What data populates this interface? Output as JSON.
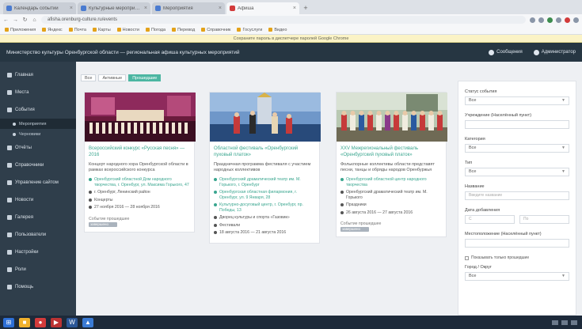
{
  "browser": {
    "tabs": [
      {
        "label": "Календарь событий",
        "active": false,
        "fav": "blue"
      },
      {
        "label": "Культурные мероприятия",
        "active": false,
        "fav": "blue"
      },
      {
        "label": "Мероприятия",
        "active": false,
        "fav": "blue"
      },
      {
        "label": "Афиша",
        "active": true,
        "fav": "red"
      }
    ],
    "url": "afisha.orenburg-culture.ru/events",
    "bookmarks": [
      "Приложения",
      "Яндекс",
      "Почта",
      "Карты",
      "Новости",
      "Погода",
      "Перевод",
      "Справочник",
      "Госуслуги",
      "Видео"
    ],
    "infobar": "Сохраните пароль в диспетчере паролей Google Chrome"
  },
  "app": {
    "title": "Министерство культуры Оренбургской области — региональная афиша культурных мероприятий",
    "header_links": [
      "Сообщения",
      "Администратор"
    ]
  },
  "sidebar": {
    "items": [
      {
        "label": "Главная",
        "sub": false,
        "active": false
      },
      {
        "label": "Места",
        "sub": false,
        "active": false
      },
      {
        "label": "События",
        "sub": false,
        "active": false
      },
      {
        "label": "Мероприятия",
        "sub": true,
        "active": true
      },
      {
        "label": "Черновики",
        "sub": true,
        "active": false
      },
      {
        "label": "Отчёты",
        "sub": false,
        "active": false
      },
      {
        "label": "Справочники",
        "sub": false,
        "active": false
      },
      {
        "label": "Управление сайтом",
        "sub": false,
        "active": false
      },
      {
        "label": "Новости",
        "sub": false,
        "active": false
      },
      {
        "label": "Галерея",
        "sub": false,
        "active": false
      },
      {
        "label": "Пользователи",
        "sub": false,
        "active": false
      },
      {
        "label": "Настройки",
        "sub": false,
        "active": false
      },
      {
        "label": "Роли",
        "sub": false,
        "active": false
      },
      {
        "label": "Помощь",
        "sub": false,
        "active": false
      }
    ]
  },
  "toolbar": {
    "tabs": [
      {
        "label": "Все",
        "active": false
      },
      {
        "label": "Активные",
        "active": false
      },
      {
        "label": "Прошедшие",
        "active": true
      }
    ]
  },
  "cards": [
    {
      "title": "Всероссийский конкурс «Русская песня» — 2016",
      "desc": "Концерт народного хора Оренбургской области в рамках всероссийского конкурса",
      "rows": [
        {
          "text": "Оренбургский областной Дом народного творчества, г. Оренбург, ул. Максима Горького, 47",
          "style": "link"
        },
        {
          "text": "г. Оренбург, Ленинский район",
          "style": "dark"
        },
        {
          "text": "Концерты",
          "style": "dark"
        },
        {
          "text": "27 ноября 2016 — 28 ноября 2016",
          "style": "dark"
        }
      ],
      "foot": "Событие прошедшее",
      "badge": "завершено"
    },
    {
      "title": "Областной фестиваль «Оренбургский пуховый платок»",
      "desc": "Праздничная программа фестиваля с участием народных коллективов",
      "rows": [
        {
          "text": "Оренбургский драматический театр им. М. Горького, г. Оренбург",
          "style": "link"
        },
        {
          "text": "Оренбургская областная филармония, г. Оренбург, ул. 9 Января, 28",
          "style": "link"
        },
        {
          "text": "Культурно-досуговый центр, г. Оренбург, пр. Победы, 13",
          "style": "link"
        },
        {
          "text": "Дворец культуры и спорта «Газовик»",
          "style": "dark"
        },
        {
          "text": "Фестивали",
          "style": "dark"
        },
        {
          "text": "18 августа 2016 — 21 августа 2016",
          "style": "dark"
        }
      ],
      "foot": "",
      "badge": ""
    },
    {
      "title": "XXV Межрегиональный фестиваль «Оренбургский пуховый платок»",
      "desc": "Фольклорные коллективы области представят песни, танцы и обряды народов Оренбуржья",
      "rows": [
        {
          "text": "Оренбургский областной центр народного творчества",
          "style": "link"
        },
        {
          "text": "Оренбургский драматический театр им. М. Горького",
          "style": "dark"
        },
        {
          "text": "Праздники",
          "style": "dark"
        },
        {
          "text": "26 августа 2016 — 27 августа 2016",
          "style": "dark"
        }
      ],
      "foot": "Событие прошедшее",
      "badge": "завершено"
    }
  ],
  "filter": {
    "fields": [
      {
        "label": "Статус события",
        "type": "select",
        "value": "Все"
      },
      {
        "label": "Учреждение (Населённый пункт)",
        "type": "input",
        "value": ""
      },
      {
        "label": "Категория",
        "type": "select",
        "value": "Все"
      },
      {
        "label": "Тип",
        "type": "select",
        "value": "Все"
      },
      {
        "label": "Название",
        "type": "input",
        "value": "Введите название"
      }
    ],
    "date_label": "Дата добавления",
    "date_from": "С",
    "date_to": "По",
    "location_label": "Местоположение (Населённый пункт)",
    "checkbox_label": "Показывать только прошедшие",
    "sort_label": "Город / Округ",
    "sort_value": "Все"
  },
  "taskbar": {
    "apps": [
      "start",
      "explorer",
      "chrome",
      "media",
      "word",
      "folder"
    ]
  }
}
